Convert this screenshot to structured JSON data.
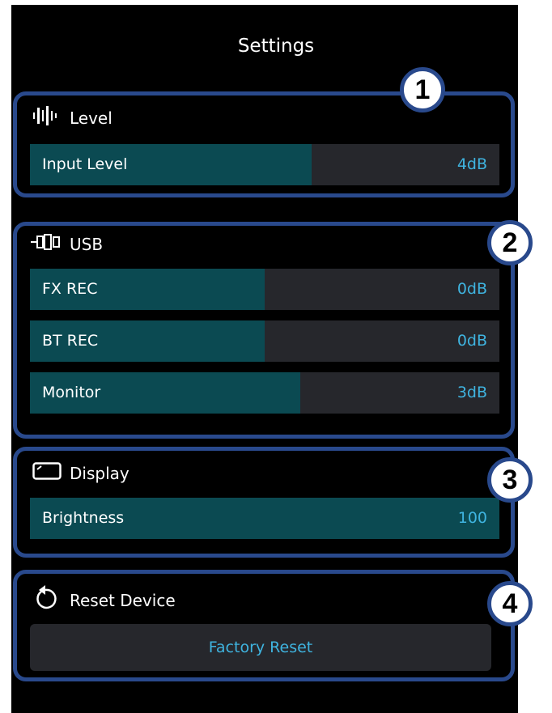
{
  "header": {
    "title": "Settings"
  },
  "sections": [
    {
      "number": "1",
      "title": "Level",
      "icon": "level-meter-icon",
      "sliders": [
        {
          "label": "Input Level",
          "value": "4dB",
          "fill_fraction": 0.6
        }
      ]
    },
    {
      "number": "2",
      "title": "USB",
      "icon": "usb-icon",
      "sliders": [
        {
          "label": "FX REC",
          "value": "0dB",
          "fill_fraction": 0.5
        },
        {
          "label": "BT REC",
          "value": "0dB",
          "fill_fraction": 0.5
        },
        {
          "label": "Monitor",
          "value": "3dB",
          "fill_fraction": 0.575
        }
      ]
    },
    {
      "number": "3",
      "title": "Display",
      "icon": "display-icon",
      "sliders": [
        {
          "label": "Brightness",
          "value": "100",
          "fill_fraction": 1.0
        }
      ]
    },
    {
      "number": "4",
      "title": "Reset Device",
      "icon": "reset-icon",
      "button": "Factory Reset"
    }
  ],
  "colors": {
    "frame": "#29498c",
    "fill": "#0b4a52",
    "track": "#26272c",
    "value": "#3fb4e0"
  }
}
